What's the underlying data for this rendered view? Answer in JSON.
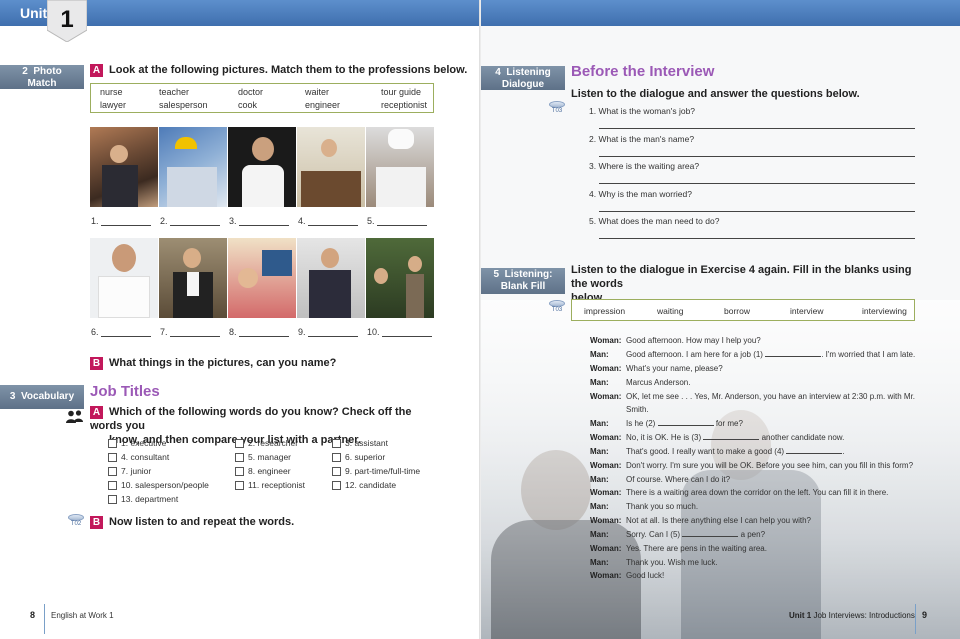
{
  "left": {
    "unit_label": "Unit",
    "unit_number": "1",
    "section2": {
      "num": "2",
      "title_line1": "Photo",
      "title_line2": "Match"
    },
    "partA": {
      "badge": "A",
      "text": "Look at the following pictures. Match them to the professions below."
    },
    "professions": [
      "nurse",
      "teacher",
      "doctor",
      "waiter",
      "tour guide",
      "lawyer",
      "salesperson",
      "cook",
      "engineer",
      "receptionist"
    ],
    "photo_labels": [
      "1.",
      "2.",
      "3.",
      "4.",
      "5.",
      "6.",
      "7.",
      "8.",
      "9.",
      "10."
    ],
    "partB": {
      "badge": "B",
      "text": "What things in the pictures, can you name?"
    },
    "section3": {
      "num": "3",
      "title": "Vocabulary"
    },
    "heading": "Job Titles",
    "vocabA": {
      "badge": "A",
      "line1": "Which of the following words do you know? Check off the words you",
      "line2": "know, and then compare your list with a partner."
    },
    "vocab_words": [
      "1. executive",
      "2. researcher",
      "3. assistant",
      "4. consultant",
      "5. manager",
      "6. superior",
      "7. junior",
      "8. engineer",
      "9. part-time/full-time",
      "10. salesperson/people",
      "11. receptionist",
      "12. candidate",
      "13. department"
    ],
    "vocabB": {
      "badge": "B",
      "text": "Now listen to and repeat the words.",
      "track": "T02"
    },
    "page_number": "8",
    "footer": "English at Work 1",
    "partner_icon": "pair-work-icon"
  },
  "right": {
    "section4": {
      "num": "4",
      "title_line1": "Listening",
      "title_line2": "Dialogue"
    },
    "heading": "Before the Interview",
    "instr": "Listen to the dialogue and answer the questions below.",
    "track1": "T03",
    "questions": [
      "1. What is the woman's job?",
      "2. What is the man's name?",
      "3. Where is the waiting area?",
      "4. Why is the man worried?",
      "5. What does the man need to do?"
    ],
    "section5": {
      "num": "5",
      "title_line1": "Listening:",
      "title_line2": "Blank Fill"
    },
    "instr2_line1": "Listen to the dialogue in Exercise 4 again. Fill in the blanks using the words",
    "instr2_line2": "below.",
    "track2": "T03",
    "fill_words": [
      "impression",
      "waiting",
      "borrow",
      "interview",
      "interviewing"
    ],
    "dialogue": [
      {
        "speaker": "Woman:",
        "a": "Good afternoon. How may I help you?",
        "b": ""
      },
      {
        "speaker": "Man:",
        "a": "Good afternoon. I am here for a job (1)",
        "b": ". I'm worried that I am late."
      },
      {
        "speaker": "Woman:",
        "a": "What's your name, please?",
        "b": ""
      },
      {
        "speaker": "Man:",
        "a": "Marcus Anderson.",
        "b": ""
      },
      {
        "speaker": "Woman:",
        "a": "OK, let me see . . . Yes, Mr. Anderson, you have an interview at 2:30 p.m. with Mr.",
        "b": ""
      },
      {
        "speaker": "",
        "a": "Smith.",
        "b": ""
      },
      {
        "speaker": "Man:",
        "a": "Is he (2)",
        "b": "for me?"
      },
      {
        "speaker": "Woman:",
        "a": "No, it is OK. He is (3)",
        "b": "another candidate now."
      },
      {
        "speaker": "Man:",
        "a": "That's good. I really want to make a good (4)",
        "b": "."
      },
      {
        "speaker": "Woman:",
        "a": "Don't worry. I'm sure you will be OK. Before you see him, can you fill in this form?",
        "b": ""
      },
      {
        "speaker": "Man:",
        "a": "Of course. Where can I do it?",
        "b": ""
      },
      {
        "speaker": "Woman:",
        "a": "There is a waiting area down the corridor on the left. You can fill it in there.",
        "b": ""
      },
      {
        "speaker": "Man:",
        "a": "Thank you so much.",
        "b": ""
      },
      {
        "speaker": "Woman:",
        "a": "Not at all. Is there anything else I can help you with?",
        "b": ""
      },
      {
        "speaker": "Man:",
        "a": "Sorry. Can I (5)",
        "b": "a pen?"
      },
      {
        "speaker": "Woman:",
        "a": "Yes. There are pens in the waiting area.",
        "b": ""
      },
      {
        "speaker": "Man:",
        "a": "Thank you. Wish me luck.",
        "b": ""
      },
      {
        "speaker": "Woman:",
        "a": "Good luck!",
        "b": ""
      }
    ],
    "footer_unit": "Unit 1",
    "footer_title": "Job Interviews: Introductions",
    "page_number": "9"
  }
}
